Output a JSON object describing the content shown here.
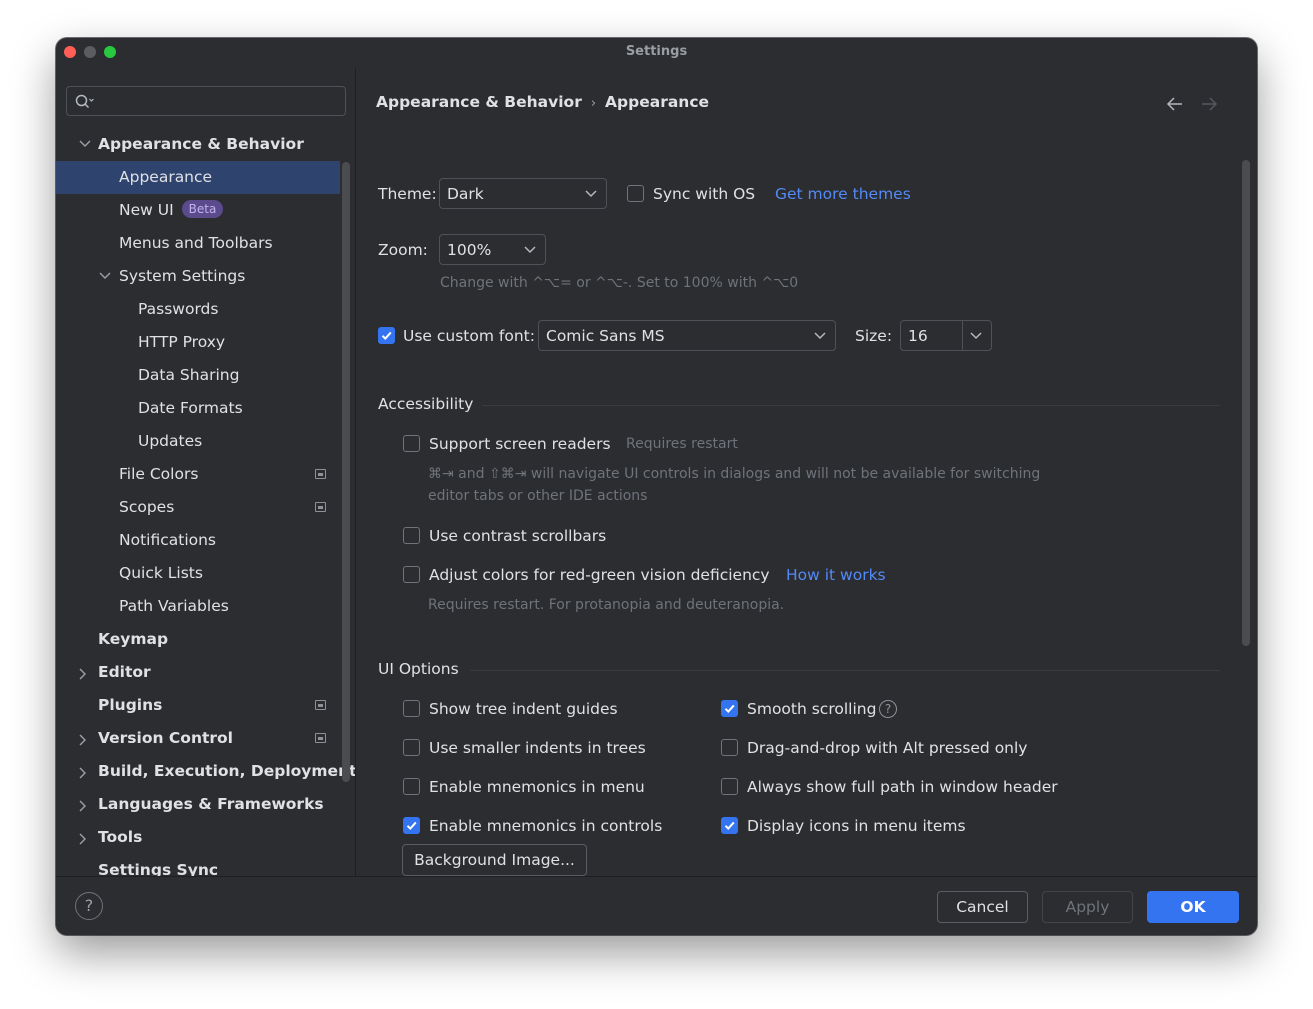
{
  "window": {
    "title": "Settings"
  },
  "sidebar": {
    "search": {
      "placeholder": "",
      "value": ""
    },
    "items": [
      {
        "label": "Appearance & Behavior",
        "level": 0,
        "expanded": true,
        "bold": true
      },
      {
        "label": "Appearance",
        "level": 1,
        "selected": true
      },
      {
        "label": "New UI",
        "level": 1,
        "badge": "Beta"
      },
      {
        "label": "Menus and Toolbars",
        "level": 1
      },
      {
        "label": "System Settings",
        "level": 1,
        "expanded": true
      },
      {
        "label": "Passwords",
        "level": 2
      },
      {
        "label": "HTTP Proxy",
        "level": 2
      },
      {
        "label": "Data Sharing",
        "level": 2
      },
      {
        "label": "Date Formats",
        "level": 2
      },
      {
        "label": "Updates",
        "level": 2
      },
      {
        "label": "File Colors",
        "level": 1,
        "project_icon": true
      },
      {
        "label": "Scopes",
        "level": 1,
        "project_icon": true
      },
      {
        "label": "Notifications",
        "level": 1
      },
      {
        "label": "Quick Lists",
        "level": 1
      },
      {
        "label": "Path Variables",
        "level": 1
      },
      {
        "label": "Keymap",
        "level": 0,
        "bold": true
      },
      {
        "label": "Editor",
        "level": 0,
        "collapsed": true,
        "bold": true
      },
      {
        "label": "Plugins",
        "level": 0,
        "bold": true,
        "project_icon": true
      },
      {
        "label": "Version Control",
        "level": 0,
        "collapsed": true,
        "bold": true,
        "project_icon": true
      },
      {
        "label": "Build, Execution, Deployment",
        "level": 0,
        "collapsed": true,
        "bold": true
      },
      {
        "label": "Languages & Frameworks",
        "level": 0,
        "collapsed": true,
        "bold": true
      },
      {
        "label": "Tools",
        "level": 0,
        "collapsed": true,
        "bold": true
      },
      {
        "label": "Settings Sync",
        "level": 0,
        "bold": true
      }
    ]
  },
  "breadcrumb": {
    "parent": "Appearance & Behavior",
    "separator": "›",
    "current": "Appearance"
  },
  "appearance": {
    "theme_label": "Theme:",
    "theme_value": "Dark",
    "sync_os_label": "Sync with OS",
    "sync_os_checked": false,
    "more_themes_link": "Get more themes",
    "zoom_label": "Zoom:",
    "zoom_value": "100%",
    "zoom_hint": "Change with ^⌥= or ^⌥-. Set to 100% with ^⌥0",
    "custom_font_label": "Use custom font:",
    "custom_font_checked": true,
    "font_value": "Comic Sans MS",
    "size_label": "Size:",
    "size_value": "16"
  },
  "accessibility": {
    "title": "Accessibility",
    "screen_readers_label": "Support screen readers",
    "screen_readers_hint": "Requires restart",
    "screen_readers_desc_1": "⌘⇥ and ⇧⌘⇥ will navigate UI controls in dialogs and will not be available for switching",
    "screen_readers_desc_2": "editor tabs or other IDE actions",
    "contrast_scrollbars_label": "Use contrast scrollbars",
    "color_deficiency_label": "Adjust colors for red-green vision deficiency",
    "how_it_works_link": "How it works",
    "color_deficiency_hint": "Requires restart. For protanopia and deuteranopia."
  },
  "ui_options": {
    "title": "UI Options",
    "left": [
      {
        "label": "Show tree indent guides",
        "checked": false
      },
      {
        "label": "Use smaller indents in trees",
        "checked": false
      },
      {
        "label": "Enable mnemonics in menu",
        "checked": false
      },
      {
        "label": "Enable mnemonics in controls",
        "checked": true
      }
    ],
    "right": [
      {
        "label": "Smooth scrolling",
        "checked": true,
        "help": "?"
      },
      {
        "label": "Drag-and-drop with Alt pressed only",
        "checked": false
      },
      {
        "label": "Always show full path in window header",
        "checked": false
      },
      {
        "label": "Display icons in menu items",
        "checked": true
      }
    ],
    "background_image_button": "Background Image..."
  },
  "footer": {
    "help": "?",
    "cancel": "Cancel",
    "apply": "Apply",
    "ok": "OK"
  },
  "colors": {
    "window_bg": "#2b2d30",
    "selection": "#2e436e",
    "accent": "#3574f0",
    "link": "#548af7",
    "text": "#dfe1e5",
    "hint": "#6f737a",
    "beta_badge_bg": "#5c4b8c"
  }
}
